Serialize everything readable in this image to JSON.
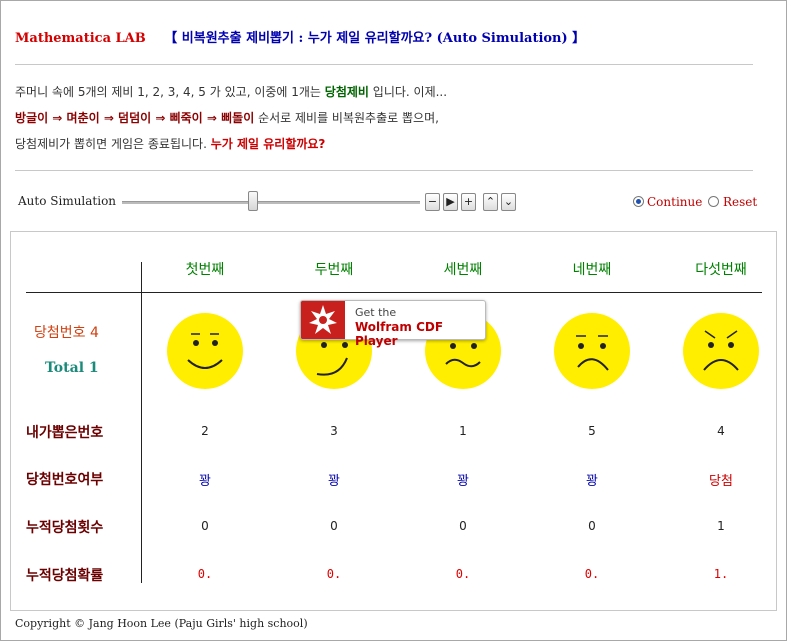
{
  "header": {
    "app": "Mathematica LAB",
    "title": "【 비복원추출 제비뽑기 : 누가 제일 유리할까요? (Auto Simulation) 】"
  },
  "description": {
    "line1_a": "주머니 속에 5개의 제비 1, 2, 3, 4, 5 가 있고, 이중에 1개는 ",
    "line1_b": "당첨제비",
    "line1_c": " 입니다. 이제...",
    "line2_a": "방글이 ⇒ 며춘이 ⇒ 덤덤이 ⇒ 삐죽이 ⇒ 삐돌이",
    "line2_b": " 순서로 제비를 비복원추출로 뽑으며,",
    "line3_a": "당첨제비가 뽑히면 게임은 종료됩니다. ",
    "line3_b": "누가 제일 유리할까요?"
  },
  "controls": {
    "label": "Auto Simulation",
    "slider_value": 0.44,
    "buttons": [
      "−",
      "▶",
      "+",
      "⌃",
      "⌄"
    ],
    "radio_continue": "Continue",
    "radio_reset": "Reset",
    "selected": "Continue"
  },
  "columns": [
    "첫번째",
    "두번째",
    "세번째",
    "네번째",
    "다섯번째"
  ],
  "status": {
    "winning_label": "당첨번호 4",
    "total_label": "Total 1"
  },
  "rows": {
    "picked_label": "내가뽑은번호",
    "picked": [
      "2",
      "3",
      "1",
      "5",
      "4"
    ],
    "result_label": "당첨번호여부",
    "result": [
      "꽝",
      "꽝",
      "꽝",
      "꽝",
      "당첨"
    ],
    "count_label": "누적당첨횟수",
    "count": [
      "0",
      "0",
      "0",
      "0",
      "1"
    ],
    "prob_label": "누적당첨확률",
    "prob": [
      "0.",
      "0.",
      "0.",
      "0.",
      "1."
    ]
  },
  "faces": [
    "smile-face-icon",
    "smirk-face-icon",
    "wavy-face-icon",
    "frown-face-icon",
    "angry-face-icon"
  ],
  "cdf": {
    "line1": "Get the",
    "line2": "Wolfram CDF Player"
  },
  "footer": "Copyright © Jang Hoon Lee (Paju Girls' high school)",
  "colors": {
    "accent_red": "#d40000",
    "title_blue": "#0000b0",
    "column_green": "#008000",
    "face_yellow": "#ffee00"
  }
}
